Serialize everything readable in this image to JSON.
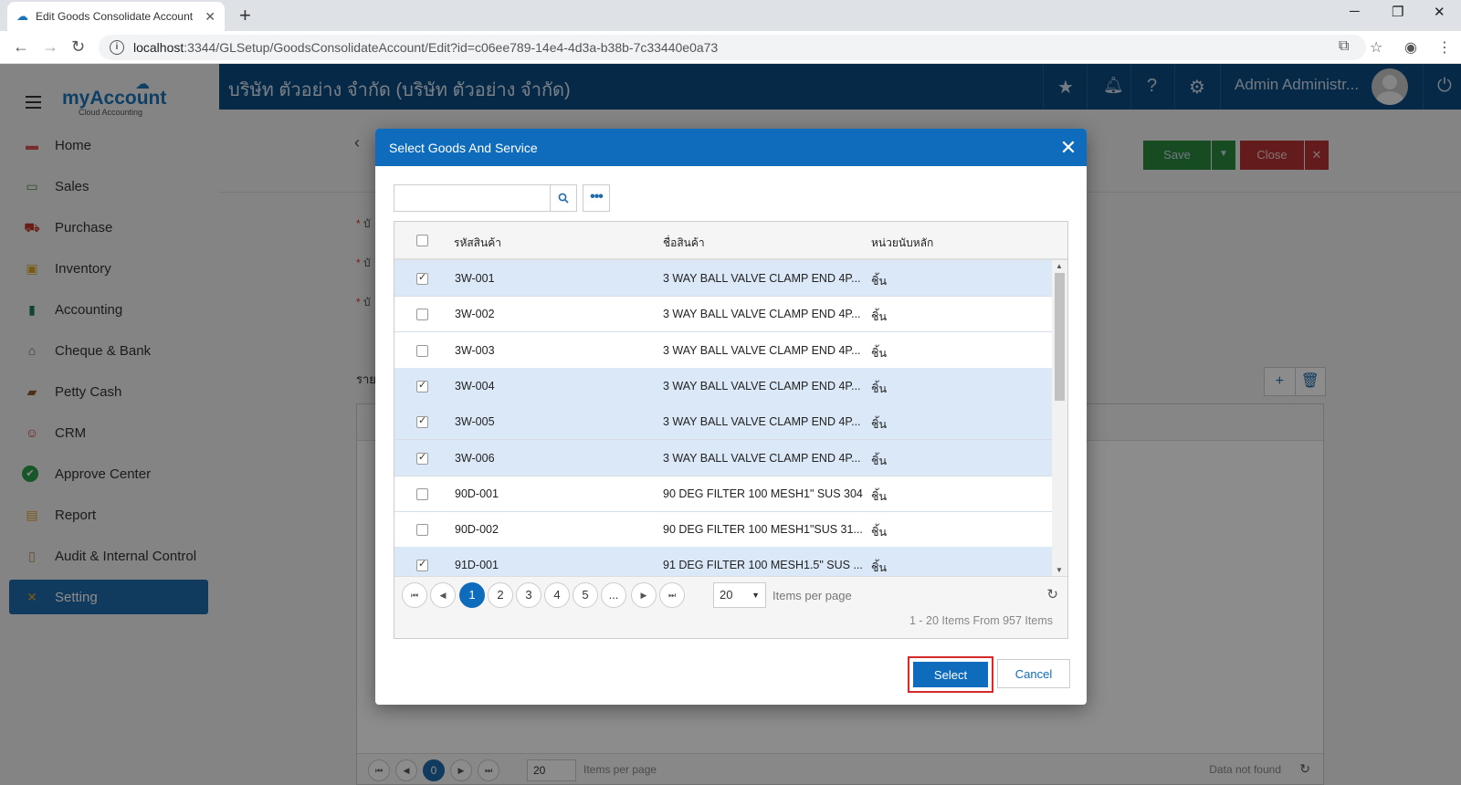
{
  "browser": {
    "tab_title": "Edit Goods Consolidate Account",
    "url_host": "localhost",
    "url_rest": ":3344/GLSetup/GoodsConsolidateAccount/Edit?id=c06ee789-14e4-4d3a-b38b-7c33440e0a73"
  },
  "app": {
    "logo_text": "myAccount",
    "logo_sub": "Cloud Accounting",
    "company": "บริษัท ตัวอย่าง จำกัด (บริษัท ตัวอย่าง จำกัด)",
    "user": "Admin Administr..."
  },
  "sidebar": {
    "items": [
      {
        "label": "Home",
        "icon": "home-icon",
        "color": "#d9534f"
      },
      {
        "label": "Sales",
        "icon": "money-icon",
        "color": "#4a8f3c"
      },
      {
        "label": "Purchase",
        "icon": "cart-icon",
        "color": "#c0392b"
      },
      {
        "label": "Inventory",
        "icon": "box-icon",
        "color": "#e0a526"
      },
      {
        "label": "Accounting",
        "icon": "book-icon",
        "color": "#1f7a5a"
      },
      {
        "label": "Cheque & Bank",
        "icon": "bank-icon",
        "color": "#7a6a4a"
      },
      {
        "label": "Petty Cash",
        "icon": "wallet-icon",
        "color": "#8a5a2a"
      },
      {
        "label": "CRM",
        "icon": "people-icon",
        "color": "#c0392b"
      },
      {
        "label": "Approve Center",
        "icon": "check-circle-icon",
        "color": "#2a9d4a"
      },
      {
        "label": "Report",
        "icon": "chart-icon",
        "color": "#e0a526"
      },
      {
        "label": "Audit & Internal Control",
        "icon": "clipboard-icon",
        "color": "#b58a4a"
      },
      {
        "label": "Setting",
        "icon": "tools-icon",
        "color": "#e0a526"
      }
    ],
    "active_index": 11
  },
  "background": {
    "save_label": "Save",
    "close_label": "Close",
    "labels": [
      "บั",
      "บั",
      "บั"
    ],
    "section": "ราย",
    "pager_current": "0",
    "pager_size": "20",
    "items_per_page": "Items per page",
    "no_data": "Data not found"
  },
  "modal": {
    "title": "Select Goods And Service",
    "search_placeholder": "",
    "columns": {
      "code": "รหัสสินค้า",
      "name": "ชื่อสินค้า",
      "unit": "หน่วยนับหลัก"
    },
    "rows": [
      {
        "checked": true,
        "code": "3W-001",
        "name": "3 WAY BALL VALVE CLAMP END 4P...",
        "unit": "ชิ้น"
      },
      {
        "checked": false,
        "code": "3W-002",
        "name": "3 WAY BALL VALVE CLAMP END 4P...",
        "unit": "ชิ้น"
      },
      {
        "checked": false,
        "code": "3W-003",
        "name": "3 WAY BALL VALVE CLAMP END 4P...",
        "unit": "ชิ้น"
      },
      {
        "checked": true,
        "code": "3W-004",
        "name": "3 WAY BALL VALVE CLAMP END 4P...",
        "unit": "ชิ้น"
      },
      {
        "checked": true,
        "code": "3W-005",
        "name": "3 WAY BALL VALVE CLAMP END 4P...",
        "unit": "ชิ้น"
      },
      {
        "checked": true,
        "code": "3W-006",
        "name": "3 WAY BALL VALVE CLAMP END 4P...",
        "unit": "ชิ้น"
      },
      {
        "checked": false,
        "code": "90D-001",
        "name": "90 DEG FILTER 100 MESH1\" SUS 304",
        "unit": "ชิ้น"
      },
      {
        "checked": false,
        "code": "90D-002",
        "name": "90 DEG FILTER 100 MESH1\"SUS 31...",
        "unit": "ชิ้น"
      },
      {
        "checked": true,
        "code": "91D-001",
        "name": "91 DEG FILTER 100 MESH1.5\" SUS ...",
        "unit": "ชิ้น"
      }
    ],
    "pager": {
      "pages": [
        "1",
        "2",
        "3",
        "4",
        "5",
        "..."
      ],
      "current": "1",
      "page_size": "20",
      "items_per_page": "Items per page",
      "summary": "1 - 20 Items From 957 Items"
    },
    "select_label": "Select",
    "cancel_label": "Cancel"
  }
}
